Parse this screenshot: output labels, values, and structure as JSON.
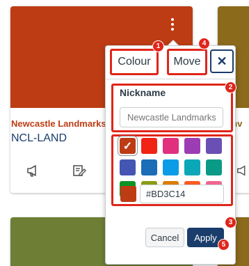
{
  "colors": {
    "card_main_hero": "#BD3C14",
    "card_right_hero": "#8C6A1C",
    "card_bottom_hero": "#6E7F35",
    "card_bottom_right_hero": "#8C6A1C",
    "course_title": "#BD3C14",
    "right_title": "#8C6A1C",
    "annotation": "#E0251A",
    "apply": "#1A3D6B"
  },
  "card": {
    "title": "Newcastle Landmarks",
    "code": "NCL-LAND",
    "icons": [
      "announcement-icon",
      "assignment-icon"
    ]
  },
  "right_card": {
    "title": "anv"
  },
  "popover": {
    "tabs": {
      "colour": "Colour",
      "move": "Move"
    },
    "close_symbol": "✕",
    "nickname": {
      "label": "Nickname",
      "value": "",
      "placeholder": "Newcastle Landmarks"
    },
    "swatches": [
      {
        "color": "#BD3C14",
        "selected": true
      },
      {
        "color": "#F02315"
      },
      {
        "color": "#E0307E"
      },
      {
        "color": "#9C3DB5"
      },
      {
        "color": "#6A4FB4"
      },
      {
        "color": "#4455B3"
      },
      {
        "color": "#1A6DB6"
      },
      {
        "color": "#0A9CE6"
      },
      {
        "color": "#09A7B7"
      },
      {
        "color": "#0B9A85"
      },
      {
        "color": "#0A9525"
      },
      {
        "color": "#8D9C10"
      },
      {
        "color": "#DB7D00"
      },
      {
        "color": "#FC5C21"
      },
      {
        "color": "#F06691"
      }
    ],
    "check_symbol": "✓",
    "hex_value": "#BD3C14",
    "cancel_label": "Cancel",
    "apply_label": "Apply"
  },
  "badges": [
    "1",
    "2",
    "3",
    "4",
    "5"
  ]
}
